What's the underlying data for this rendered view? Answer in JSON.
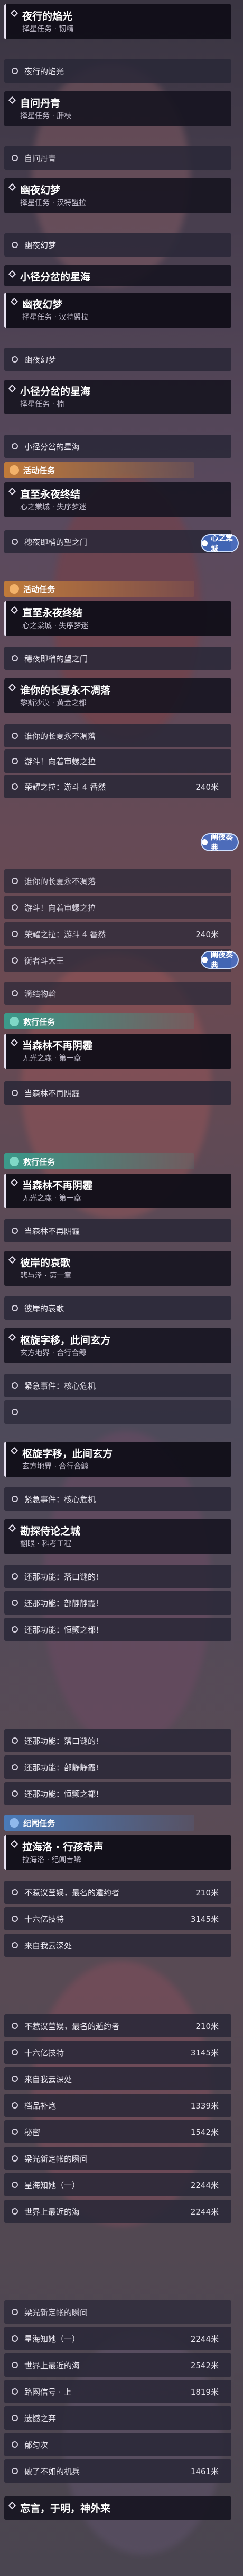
{
  "colors": {
    "orange": "#c07a3a",
    "teal": "#3c9a8a",
    "blue": "#4a7ab8",
    "card": "#16141f",
    "obj": "#2a2838"
  },
  "screens": [
    {
      "cards": [
        {
          "title": "夜行的焰光",
          "sub": "择星任务 · 韧精"
        },
        {
          "title": "",
          "sub": ""
        }
      ],
      "items": [
        {
          "label": "夜行的焰光"
        },
        {
          "label": ""
        },
        {
          "label": "自问丹青"
        },
        {
          "label": "择星任务 · 肝枝"
        },
        {
          "label": "自问丹青"
        }
      ]
    }
  ],
  "s1": {
    "card1": {
      "title": "夜行的焰光",
      "sub": "择星任务 · 韧精"
    },
    "obj1": "夜行的焰光",
    "card2": {
      "title": "自问丹青",
      "sub": "择星任务 · 肝枝"
    },
    "obj2": "自问丹青",
    "card3": {
      "title": "幽夜幻梦",
      "sub": "择星任务 · 汉特盟拉"
    },
    "obj3": "幽夜幻梦",
    "card4": {
      "title": "小径分岔的星海",
      "sub": ""
    }
  },
  "s2": {
    "card1": {
      "title": "幽夜幻梦",
      "sub": "择星任务 · 汉特盟拉"
    },
    "obj1": "幽夜幻梦",
    "card2": {
      "title": "小径分岔的星海",
      "sub": "择星任务 · 楠"
    },
    "obj2": "小径分岔的星海",
    "group": "活动任务",
    "card3": {
      "title": "直至永夜终结",
      "sub": "心之棠城 · 失序梦迷"
    },
    "obj3": "穗夜即梢的望之门",
    "track": "心之棠城"
  },
  "s3": {
    "group": "活动任务",
    "card1": {
      "title": "直至永夜终结",
      "sub": "心之棠城 · 失序梦迷"
    },
    "obj1": "穗夜即梢的望之门",
    "card2": {
      "title": "谁你的长夏永不凋落",
      "sub": "黎斯沙漠 · 黄金之都"
    },
    "obj2": "谁你的长夏永不凋落",
    "obj3": "游斗！向着审螺之拉",
    "obj4": "荣耀之拉：游斗 4 番然",
    "obj4dist": "240米",
    "track": "阐夜奏典"
  },
  "s4": {
    "obj1": "谁你的长夏永不凋落",
    "obj2": "游斗！向着审螺之拉",
    "obj3": "荣耀之拉：游斗 4 番然",
    "obj3dist": "240米",
    "obj4": "衡者斗大王",
    "track": "阐夜奏典",
    "obj5": "滴结物斡",
    "group": "救行任务",
    "card1": {
      "title": "当森林不再阴霾",
      "sub": "无光之森 · 第一章"
    },
    "obj6": "当森林不再阴霾"
  },
  "s5": {
    "group": "救行任务",
    "card1": {
      "title": "当森林不再阴霾",
      "sub": "无光之森 · 第一章"
    },
    "obj1": "当森林不再阴霾",
    "card2": {
      "title": "彼岸的哀歌",
      "sub": "悲与泽 · 第一章"
    },
    "obj2": "彼岸的哀歌",
    "card3": {
      "title": "枢旋字移，此间玄方",
      "sub": "玄方地界 · 合行合鲸"
    },
    "obj3": "紧急事件：核心危机",
    "obj4": ""
  },
  "s6": {
    "card1": {
      "title": "枢旋字移，此间玄方",
      "sub": "玄方地界 · 合行合鲸"
    },
    "obj1": "紧急事件：核心危机",
    "card2": {
      "title": "勘探侍论之城",
      "sub": "翻眼 · 科考工程"
    },
    "obj2": "还那功能：落口谜的!",
    "obj3": "还那功能：部静静霞!",
    "obj4": "还那功能：恒颤之都！"
  },
  "s7": {
    "obj1": "还那功能：落口谜的!",
    "obj2": "还那功能：部静静霞!",
    "obj3": "还那功能：恒颤之都！",
    "group": "纪闻任务",
    "card1": {
      "title": "拉海洛 · 行孩奇声",
      "sub": "拉海洛 · 纪闻吉鳞"
    },
    "obj4": "不惹议莹娱，最名的遁约者",
    "obj4dist": "210米",
    "obj5": "十六亿技特",
    "obj5dist": "3145米",
    "obj6": "来自我云深处"
  },
  "s8": {
    "obj1": "不惹议莹娱，最名的遁约者",
    "obj1dist": "210米",
    "obj2": "十六亿技特",
    "obj2dist": "3145米",
    "obj3": "来自我云深处",
    "obj4": "档品补炮",
    "obj4dist": "1339米",
    "obj5": "秘密",
    "obj5dist": "1542米",
    "obj6": "梁光新定帐的瞬间",
    "obj7": "星海知她（一）",
    "obj7dist": "2244米",
    "obj8": "世界上最近的海",
    "obj8dist": "2244米"
  },
  "s9": {
    "obj1": "梁光新定帐的瞬间",
    "obj2": "星海知她（一）",
    "obj2dist": "2244米",
    "obj3": "世界上最近的海",
    "obj3dist": "2542米",
    "obj4": "路网信号 · 上",
    "obj4dist": "1819米",
    "obj5": "遗憾之弃",
    "obj6": "郁匀次",
    "obj7": "破了不如的机兵",
    "obj7dist": "1461米",
    "card1": {
      "title": "忘言，于明，神外来",
      "sub": ""
    }
  }
}
